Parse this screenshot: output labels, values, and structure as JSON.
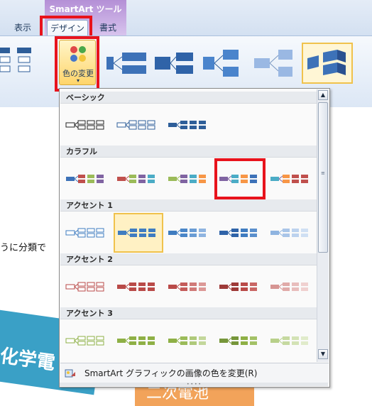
{
  "ribbon": {
    "context_title": "SmartArt ツール",
    "tabs": [
      {
        "label": "表示"
      },
      {
        "label": "デザイン"
      },
      {
        "label": "書式"
      }
    ],
    "change_colors_label": "色の変更",
    "change_colors_arrow": "▾"
  },
  "document": {
    "body_text": "うに分類で",
    "shape_text_left": "化学電",
    "shape_text_bottom": "二次電池"
  },
  "dropdown": {
    "sections": [
      {
        "title": "ベーシック"
      },
      {
        "title": "カラフル"
      },
      {
        "title": "アクセント 1"
      },
      {
        "title": "アクセント 2"
      },
      {
        "title": "アクセント 3"
      }
    ],
    "footer_label": "SmartArt グラフィックの画像の色を変更(R)",
    "scroll_up": "▲",
    "scroll_down": "▼",
    "grip": "≡",
    "resize_grip": "• • • •"
  },
  "colors": {
    "accent_red": "#e8131c",
    "highlight": "#f0c24c",
    "dark_blue": "#2e5e99",
    "accent1": "#3f7cc0",
    "accent2": "#b94a48",
    "accent3": "#8eb045"
  }
}
